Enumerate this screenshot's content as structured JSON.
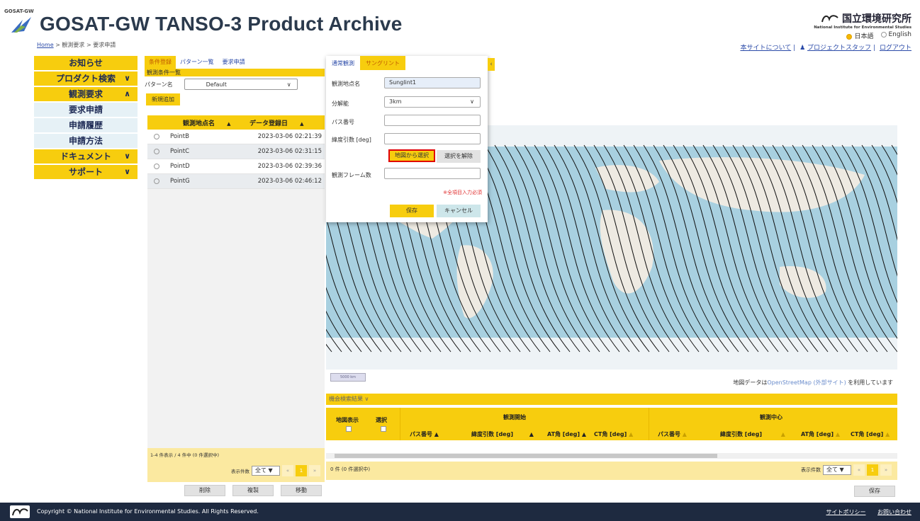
{
  "header": {
    "brand_small": "GOSAT-GW",
    "title": "GOSAT-GW TANSO-3 Product Archive",
    "nies_jp": "国立環境研究所",
    "nies_en": "National Institute for Environmental Studies",
    "lang_ja": "日本語",
    "lang_en": "English",
    "breadcrumb_home": "Home",
    "breadcrumb_rest": " > 観測要求 > 要求申請",
    "links": [
      "本サイトについて",
      "プロジェクトスタッフ",
      "ログアウト"
    ]
  },
  "sidebar": {
    "items": [
      {
        "label": "お知らせ",
        "chev": ""
      },
      {
        "label": "プロダクト検索",
        "chev": "∨"
      },
      {
        "label": "観測要求",
        "chev": "∧"
      }
    ],
    "sub": [
      "要求申請",
      "申請履歴",
      "申請方法"
    ],
    "items2": [
      {
        "label": "ドキュメント",
        "chev": "∨"
      },
      {
        "label": "サポート",
        "chev": "∨"
      }
    ]
  },
  "left": {
    "tabs": [
      "条件登録",
      "パターン一覧",
      "要求申請"
    ],
    "section": "観測条件一覧",
    "pattern_label": "パターン名",
    "pattern_value": "Default",
    "new_button": "新規追加",
    "col_name": "観測地点名",
    "col_date": "データ登録日",
    "rows": [
      {
        "name": "PointB",
        "date": "2023-03-06 02:21:39"
      },
      {
        "name": "PointC",
        "date": "2023-03-06 02:31:15"
      },
      {
        "name": "PointD",
        "date": "2023-03-06 02:39:36"
      },
      {
        "name": "PointG",
        "date": "2023-03-06 02:46:12"
      }
    ],
    "count_text": "1-4 件表示 / 4 件中 (0 件選択中)",
    "per_page_label": "表示件数",
    "per_page_value": "全て",
    "page_current": "1",
    "buttons": [
      "削除",
      "複製",
      "移動"
    ]
  },
  "popup": {
    "tabs": [
      "通常観測",
      "サングリント"
    ],
    "fields": [
      {
        "label": "観測地点名",
        "value": "Sunglint1"
      },
      {
        "label": "分解能",
        "value": "3km"
      },
      {
        "label": "パス番号",
        "value": ""
      },
      {
        "label": "緯度引数 [deg]",
        "value": ""
      },
      {
        "label": "観測フレーム数",
        "value": ""
      }
    ],
    "btn_map_select": "地図から選択",
    "btn_clear": "選択を解除",
    "required_note": "※全項目入力必須",
    "btn_save": "保存",
    "btn_cancel": "キャンセル"
  },
  "map": {
    "scale": "5000 km",
    "osm_prefix": "地図データは",
    "osm_link": "OpenStreetMap (外部サイト)",
    "osm_suffix": " を利用しています"
  },
  "results": {
    "bar_label": "機会検索結果",
    "col_map": "地図表示",
    "col_select": "選択",
    "group_start": "観測開始",
    "group_center": "観測中心",
    "sub_cols": [
      "パス番号",
      "緯度引数 [deg]",
      "AT角 [deg]",
      "CT角 [deg]"
    ],
    "count_text": "0 件 (0 件選択中)",
    "per_page_label": "表示件数",
    "per_page_value": "全て",
    "page_current": "1",
    "save": "保存"
  },
  "footer": {
    "copyright": "Copyright © National Institute for Environmental Studies. All Rights Reserved.",
    "links": [
      "サイトポリシー",
      "お問い合わせ"
    ]
  }
}
